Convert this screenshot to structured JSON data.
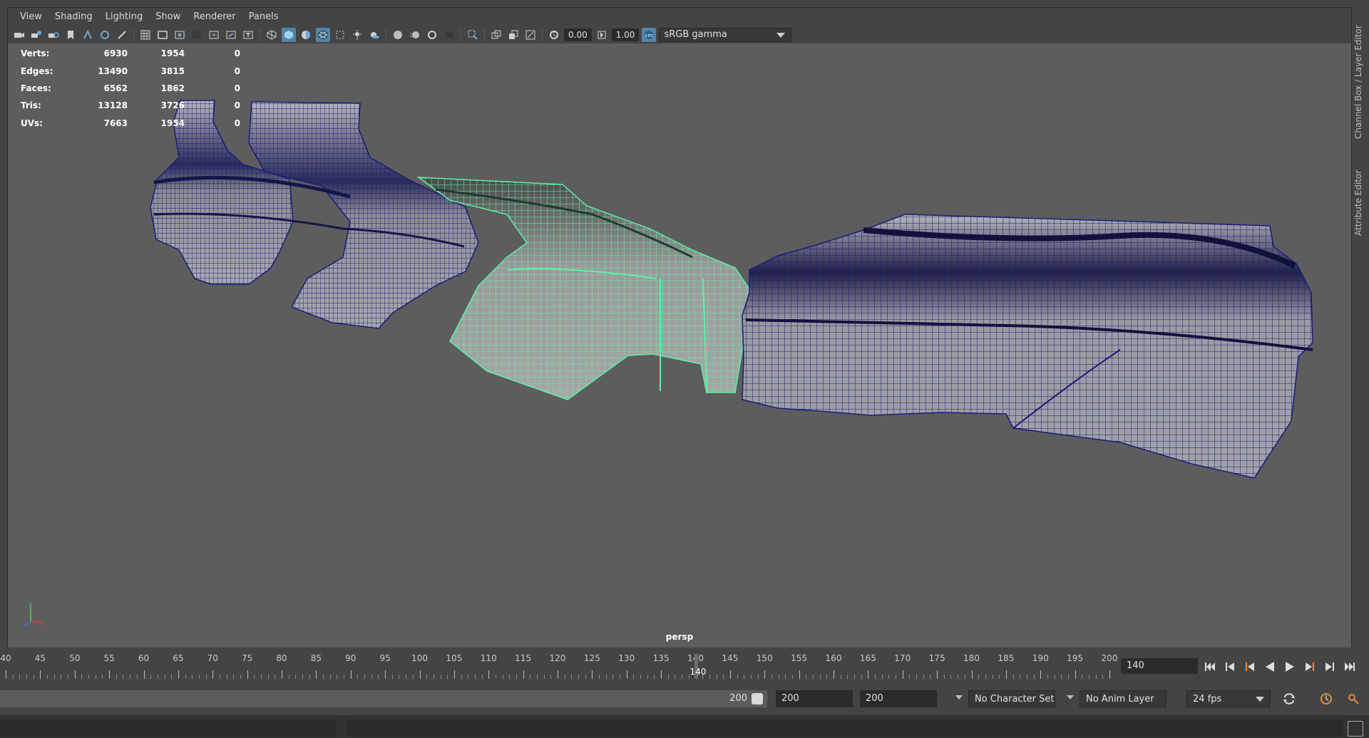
{
  "menus": [
    "View",
    "Shading",
    "Lighting",
    "Show",
    "Renderer",
    "Panels"
  ],
  "toolbar": {
    "exposure_value": "0.00",
    "gamma_value": "1.00",
    "color_space": "sRGB gamma",
    "icons": [
      "camera-icon",
      "camera-attributes-icon",
      "bookmark-icon",
      "image-plane-icon",
      "grid-icon",
      "film-gate-icon",
      "resolution-gate-icon",
      "gate-mask-icon",
      "field-chart-icon",
      "safe-action-icon",
      "safe-title-icon",
      "wireframe-icon",
      "smooth-shade-icon",
      "default-material-icon",
      "wireframe-on-shaded-icon",
      "xray-icon",
      "use-all-lights-icon",
      "shadows-icon",
      "screen-space-ao-icon",
      "motion-blur-icon",
      "multisample-aa-icon",
      "depth-of-field-icon",
      "isolate-select-icon",
      "xray-joints-icon",
      "backface-icon",
      "exposure-icon",
      "gamma-icon",
      "color-management-icon"
    ]
  },
  "hud": {
    "rows": [
      {
        "label": "Verts:",
        "v1": "6930",
        "v2": "1954",
        "v3": "0"
      },
      {
        "label": "Edges:",
        "v1": "13490",
        "v2": "3815",
        "v3": "0"
      },
      {
        "label": "Faces:",
        "v1": "6562",
        "v2": "1862",
        "v3": "0"
      },
      {
        "label": "Tris:",
        "v1": "13128",
        "v2": "3726",
        "v3": "0"
      },
      {
        "label": "UVs:",
        "v1": "7663",
        "v2": "1954",
        "v3": "0"
      }
    ]
  },
  "camera_label": "persp",
  "side_tabs": {
    "channel_box": "Channel Box / Layer Editor",
    "attribute_editor": "Attribute Editor"
  },
  "timeline": {
    "ticks": [
      "40",
      "45",
      "50",
      "55",
      "60",
      "65",
      "70",
      "75",
      "80",
      "85",
      "90",
      "95",
      "100",
      "105",
      "110",
      "115",
      "120",
      "125",
      "130",
      "135",
      "140",
      "145",
      "150",
      "155",
      "160",
      "165",
      "170",
      "175",
      "180",
      "185",
      "190",
      "195",
      "200"
    ],
    "current_frame": "140",
    "current_frame_field": "140"
  },
  "range": {
    "slider_end": "200",
    "anim_end": "200",
    "range_end": "200",
    "character_set": "No Character Set",
    "anim_layer": "No Anim Layer",
    "fps": "24 fps"
  },
  "colors": {
    "viewport_bg": "#5d5d5d",
    "mesh_wire": "#1b1c7a",
    "mesh_fill": "#9c9ca2",
    "selected_wire": "#5ef0a8",
    "ui_bg": "#444444",
    "accent": "#5285a6"
  }
}
